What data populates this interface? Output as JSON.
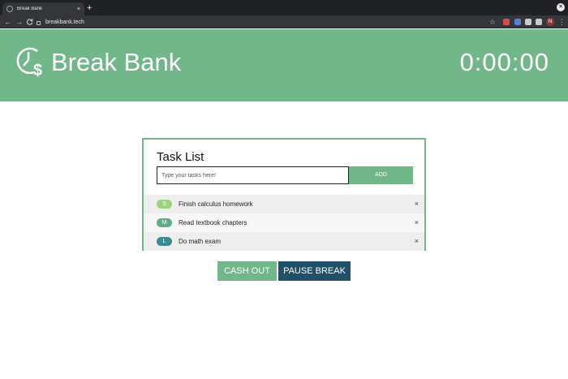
{
  "browser": {
    "tab_title": "Break Bank",
    "tab_close": "×",
    "new_tab": "+",
    "window_close": "×",
    "back": "←",
    "forward": "→",
    "reload": "C",
    "url": "breakbank.tech",
    "bookmark": "☆",
    "profile_initial": "N",
    "menu": "⋮",
    "extension_colors": [
      "#d04e4e",
      "#5b7fd6",
      "#c8cacd",
      "#c8cacd"
    ]
  },
  "header": {
    "brand": "Break Bank",
    "timer": "0:00:00",
    "logo_icon": "clock-dollar-icon"
  },
  "tasks": {
    "title": "Task List",
    "input_placeholder": "Type your tasks here!",
    "input_value": "",
    "add_label": "ADD",
    "items": [
      {
        "size": "S",
        "size_color": "#9cd17d",
        "text": "Finish calculus homework",
        "remove": "×"
      },
      {
        "size": "M",
        "size_color": "#5fae8a",
        "text": "Read textbook chapters",
        "remove": "×"
      },
      {
        "size": "L",
        "size_color": "#3d8a8e",
        "text": "Do math exam",
        "remove": "×"
      }
    ]
  },
  "actions": {
    "cash_out": "CASH OUT",
    "pause_break": "PAUSE BREAK"
  },
  "colors": {
    "brand_green": "#72b78a",
    "dark_teal": "#215069"
  }
}
